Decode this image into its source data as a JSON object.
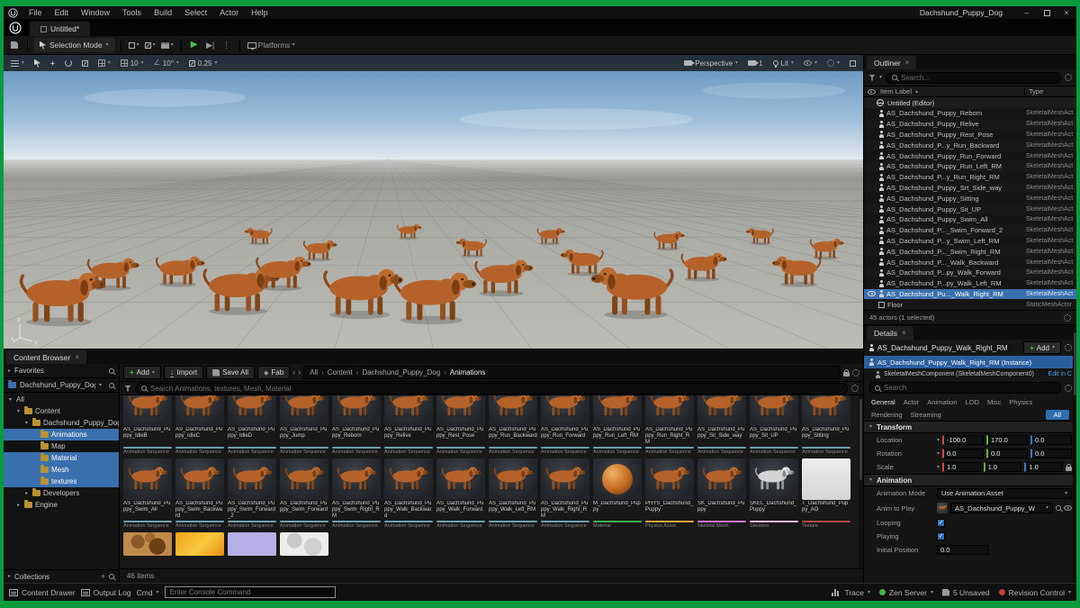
{
  "icons": {
    "chevron": "▾",
    "expand": "▸",
    "play": "▶",
    "skip": "▶|",
    "kebab": "⋮",
    "close": "×",
    "minimize": "–",
    "back": "‹",
    "forward": "›",
    "plus": "+",
    "sort_asc": "▲",
    "diamond": "◆",
    "star": "★",
    "import_arrow": "↓"
  },
  "colors": {
    "anim": "#6f9fae",
    "material": "#3fae4f",
    "physics": "#e8a33d",
    "skmesh": "#d976d3",
    "skeleton": "#e4b9d2",
    "texture": "#b04a4a",
    "selection": "#3a70ad",
    "accent_green": "#49c349"
  },
  "window": {
    "title": "Dachshund_Puppy_Dog"
  },
  "menu": {
    "items": [
      "File",
      "Edit",
      "Window",
      "Tools",
      "Build",
      "Select",
      "Actor",
      "Help"
    ]
  },
  "tab": {
    "label": "Untitled*"
  },
  "toolbar": {
    "selection_mode": "Selection Mode",
    "platforms": "Platforms"
  },
  "viewport": {
    "perspective": "Perspective",
    "camera_speed": "1",
    "view_mode": "Lit",
    "grid_snap": "10",
    "rotation_snap": "10°",
    "scale_snap": "0.25"
  },
  "outliner": {
    "title": "Outliner",
    "search_placeholder": "Search...",
    "item_label_col": "Item Label",
    "type_col": "Type",
    "world_label": "Untitled (Editor)",
    "rows": [
      {
        "label": "AS_Dachshund_Puppy_Reborn",
        "type": "SkeletalMeshAct"
      },
      {
        "label": "AS_Dachshund_Puppy_Relive",
        "type": "SkeletalMeshAct"
      },
      {
        "label": "AS_Dachshund_Puppy_Rest_Pose",
        "type": "SkeletalMeshAct"
      },
      {
        "label": "AS_Dachshund_P...y_Run_Backward",
        "type": "SkeletalMeshAct"
      },
      {
        "label": "AS_Dachshund_Puppy_Run_Forward",
        "type": "SkeletalMeshAct"
      },
      {
        "label": "AS_Dachshund_Puppy_Run_Left_RM",
        "type": "SkeletalMeshAct"
      },
      {
        "label": "AS_Dachshund_P...y_Run_Right_RM",
        "type": "SkeletalMeshAct"
      },
      {
        "label": "AS_Dachshund_Puppy_Srt_Side_way",
        "type": "SkeletalMeshAct"
      },
      {
        "label": "AS_Dachshund_Puppy_Sitting",
        "type": "SkeletalMeshAct"
      },
      {
        "label": "AS_Dachshund_Puppy_Sit_UP",
        "type": "SkeletalMeshAct"
      },
      {
        "label": "AS_Dachshund_Puppy_Swim_All",
        "type": "SkeletalMeshAct"
      },
      {
        "label": "AS_Dachshund_P..._Swim_Forward_2",
        "type": "SkeletalMeshAct"
      },
      {
        "label": "AS_Dachshund_P...y_Swim_Left_RM",
        "type": "SkeletalMeshAct"
      },
      {
        "label": "AS_Dachshund_P..._Swim_Right_RM",
        "type": "SkeletalMeshAct"
      },
      {
        "label": "AS_Dachshund_P..._Walk_Backward",
        "type": "SkeletalMeshAct"
      },
      {
        "label": "AS_Dachshund_P...py_Walk_Forward",
        "type": "SkeletalMeshAct"
      },
      {
        "label": "AS_Dachshund_P...py_Walk_Left_RM",
        "type": "SkeletalMeshAct"
      },
      {
        "label": "AS_Dachshund_Pu..._Walk_Right_RM",
        "type": "SkeletalMeshAct",
        "selected": true
      },
      {
        "label": "Floor",
        "type": "StaticMeshActor",
        "icon": "cube"
      }
    ],
    "footer": "45 actors (1 selected)"
  },
  "details": {
    "title": "Details",
    "actor_name": "AS_Dachshund_Puppy_Walk_Right_RM",
    "add_label": "Add",
    "instance_label": "AS_Dachshund_Puppy_Walk_Right_RM (Instance)",
    "component_label": "SkeletalMeshComponent (SkeletalMeshComponent0)",
    "edit_link": "Edit in C",
    "search_placeholder": "Search",
    "tabs": [
      "General",
      "Actor",
      "Animation",
      "LOD",
      "Misc",
      "Physics"
    ],
    "tabs2": [
      "Rendering",
      "Streaming"
    ],
    "all_chip": "All",
    "transform": {
      "section": "Transform",
      "location": {
        "label": "Location",
        "x": "-100.0",
        "y": "170.0",
        "z": "0.0"
      },
      "rotation": {
        "label": "Rotation",
        "x": "0.0",
        "y": "0.0",
        "z": "0.0"
      },
      "scale": {
        "label": "Scale",
        "x": "1.0",
        "y": "1.0",
        "z": "1.0"
      }
    },
    "animation": {
      "section": "Animation",
      "mode_label": "Animation Mode",
      "mode_value": "Use Animation Asset",
      "anim_label": "Anim to Play",
      "anim_value": "AS_Dachshund_Puppy_W",
      "looping_label": "Looping",
      "looping": true,
      "playing_label": "Playing",
      "playing": true,
      "initial_label": "Initial Position",
      "initial_value": "0.0"
    }
  },
  "content_browser": {
    "title": "Content Browser",
    "favorites_label": "Favorites",
    "project_label": "Dachshund_Puppy_Dog",
    "add_label": "Add",
    "import_label": "Import",
    "save_all_label": "Save All",
    "fab_label": "Fab",
    "breadcrumbs": [
      "All",
      "Content",
      "Dachshund_Puppy_Dog",
      "Animations"
    ],
    "search_placeholder": "Search Animations, textures, Mesh, Material",
    "tree": [
      {
        "label": "All",
        "depth": 0,
        "children": true,
        "expanded": true,
        "folder": false,
        "selected": false
      },
      {
        "label": "Content",
        "depth": 1,
        "children": true,
        "expanded": true,
        "folder": true,
        "selected": false
      },
      {
        "label": "Dachshund_Puppy_Dog",
        "depth": 2,
        "children": true,
        "expanded": true,
        "folder": true,
        "selected": false
      },
      {
        "label": "Animations",
        "depth": 3,
        "children": false,
        "folder": true,
        "selected": true
      },
      {
        "label": "Map",
        "depth": 3,
        "children": false,
        "folder": true,
        "selected": false
      },
      {
        "label": "Material",
        "depth": 3,
        "children": false,
        "folder": true,
        "selected": true
      },
      {
        "label": "Mesh",
        "depth": 3,
        "children": false,
        "folder": true,
        "selected": true
      },
      {
        "label": "textures",
        "depth": 3,
        "children": false,
        "folder": true,
        "selected": true
      },
      {
        "label": "Developers",
        "depth": 2,
        "children": true,
        "expanded": false,
        "folder": true,
        "selected": false
      },
      {
        "label": "Engine",
        "depth": 1,
        "children": true,
        "expanded": false,
        "folder": true,
        "selected": false
      }
    ],
    "collections_label": "Collections",
    "items_count": "46 items",
    "assets": [
      {
        "name": "AS_Dachshund_Puppy_IdleB",
        "type": "Animation Sequence",
        "kind": "anim"
      },
      {
        "name": "AS_Dachshund_Puppy_IdleC",
        "type": "Animation Sequence",
        "kind": "anim"
      },
      {
        "name": "AS_Dachshund_Puppy_IdleD",
        "type": "Animation Sequence",
        "kind": "anim"
      },
      {
        "name": "AS_Dachshund_Puppy_Jump",
        "type": "Animation Sequence",
        "kind": "anim"
      },
      {
        "name": "AS_Dachshund_Puppy_Reborn",
        "type": "Animation Sequence",
        "kind": "anim"
      },
      {
        "name": "AS_Dachshund_Puppy_Relive",
        "type": "Animation Sequence",
        "kind": "anim"
      },
      {
        "name": "AS_Dachshund_Puppy_Rest_Pose",
        "type": "Animation Sequence",
        "kind": "anim"
      },
      {
        "name": "AS_Dachshund_Puppy_Run_Backward",
        "type": "Animation Sequence",
        "kind": "anim"
      },
      {
        "name": "AS_Dachshund_Puppy_Run_Forward",
        "type": "Animation Sequence",
        "kind": "anim"
      },
      {
        "name": "AS_Dachshund_Puppy_Run_Left_RM",
        "type": "Animation Sequence",
        "kind": "anim"
      },
      {
        "name": "AS_Dachshund_Puppy_Run_Right_RM",
        "type": "Animation Sequence",
        "kind": "anim"
      },
      {
        "name": "AS_Dachshund_Puppy_Sit_Side_way",
        "type": "Animation Sequence",
        "kind": "anim"
      },
      {
        "name": "AS_Dachshund_Puppy_Sit_UP",
        "type": "Animation Sequence",
        "kind": "anim"
      },
      {
        "name": "AS_Dachshund_Puppy_Sitting",
        "type": "Animation Sequence",
        "kind": "anim"
      },
      {
        "name": "AS_Dachshund_Puppy_Swim_All",
        "type": "Animation Sequence",
        "kind": "anim"
      },
      {
        "name": "AS_Dachshund_Puppy_Swim_Backward",
        "type": "Animation Sequence",
        "kind": "anim"
      },
      {
        "name": "AS_Dachshund_Puppy_Swim_Forward_2",
        "type": "Animation Sequence",
        "kind": "anim"
      },
      {
        "name": "AS_Dachshund_Puppy_Swim_Forward",
        "type": "Animation Sequence",
        "kind": "anim"
      },
      {
        "name": "AS_Dachshund_Puppy_Swim_Right_RM",
        "type": "Animation Sequence",
        "kind": "anim"
      },
      {
        "name": "AS_Dachshund_Puppy_Walk_Backward",
        "type": "Animation Sequence",
        "kind": "anim"
      },
      {
        "name": "AS_Dachshund_Puppy_Walk_Forward",
        "type": "Animation Sequence",
        "kind": "anim"
      },
      {
        "name": "AS_Dachshund_Puppy_Walk_Left_RM",
        "type": "Animation Sequence",
        "kind": "anim"
      },
      {
        "name": "AS_Dachshund_Puppy_Walk_Right_RM",
        "type": "Animation Sequence",
        "kind": "anim"
      },
      {
        "name": "M_Dachshund_Puppy",
        "type": "Material",
        "kind": "material"
      },
      {
        "name": "PHYS_Dachshund_Puppy",
        "type": "Physics Asset",
        "kind": "physics"
      },
      {
        "name": "SK_Dachshund_Puppy",
        "type": "Skeletal Mesh",
        "kind": "skmesh"
      },
      {
        "name": "SKEL_Dachshund_Puppy",
        "type": "Skeleton",
        "kind": "skeleton"
      },
      {
        "name": "T_Dachshund_Puppy_AO",
        "type": "Texture",
        "kind": "texture"
      }
    ],
    "texture_thumbs": [
      "brown",
      "orange",
      "lavender",
      "white"
    ]
  },
  "statusbar": {
    "content_drawer": "Content Drawer",
    "output_log": "Output Log",
    "cmd": "Cmd",
    "console_placeholder": "Enter Console Command",
    "trace": "Trace",
    "zen_server": "Zen Server",
    "unsaved": "5 Unsaved",
    "revision_control": "Revision Control"
  }
}
